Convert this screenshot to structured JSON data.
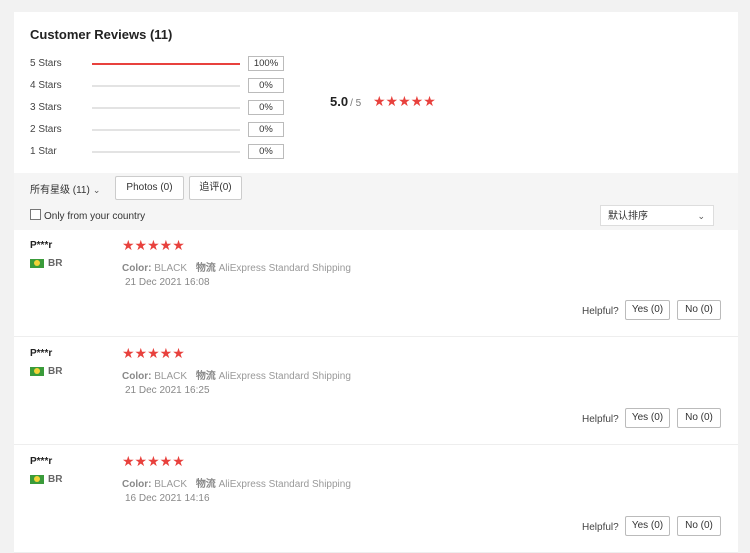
{
  "summary": {
    "title": "Customer Reviews",
    "count": "(11)",
    "rows": [
      {
        "label": "5 Stars",
        "pct": "100%",
        "fraction": 1.0
      },
      {
        "label": "4 Stars",
        "pct": "0%",
        "fraction": 0
      },
      {
        "label": "3 Stars",
        "pct": "0%",
        "fraction": 0
      },
      {
        "label": "2 Stars",
        "pct": "0%",
        "fraction": 0
      },
      {
        "label": "1 Star",
        "pct": "0%",
        "fraction": 0
      }
    ],
    "score": "5.0",
    "out_of": "/ 5",
    "stars": "★★★★★"
  },
  "filters": {
    "all_stars": "所有星级 (11)",
    "photos": "Photos (0)",
    "followup": "追评(0)",
    "country_only": "Only from your country",
    "sort": "默认排序"
  },
  "reviews": [
    {
      "user": "P***r",
      "country": "BR",
      "stars": "★★★★★",
      "color_label": "Color:",
      "color": "BLACK",
      "ship_label": "物流",
      "ship": "AliExpress Standard Shipping",
      "date": "21 Dec 2021 16:08",
      "helpful": "Helpful?",
      "yes": "Yes (0)",
      "no": "No (0)"
    },
    {
      "user": "P***r",
      "country": "BR",
      "stars": "★★★★★",
      "color_label": "Color:",
      "color": "BLACK",
      "ship_label": "物流",
      "ship": "AliExpress Standard Shipping",
      "date": "21 Dec 2021 16:25",
      "helpful": "Helpful?",
      "yes": "Yes (0)",
      "no": "No (0)"
    },
    {
      "user": "P***r",
      "country": "BR",
      "stars": "★★★★★",
      "color_label": "Color:",
      "color": "BLACK",
      "ship_label": "物流",
      "ship": "AliExpress Standard Shipping",
      "date": "16 Dec 2021 14:16",
      "helpful": "Helpful?",
      "yes": "Yes (0)",
      "no": "No (0)"
    }
  ],
  "colors": {
    "accent": "#e8413d",
    "flag_green": "#3a9b3a",
    "flag_yellow": "#f2d338"
  }
}
